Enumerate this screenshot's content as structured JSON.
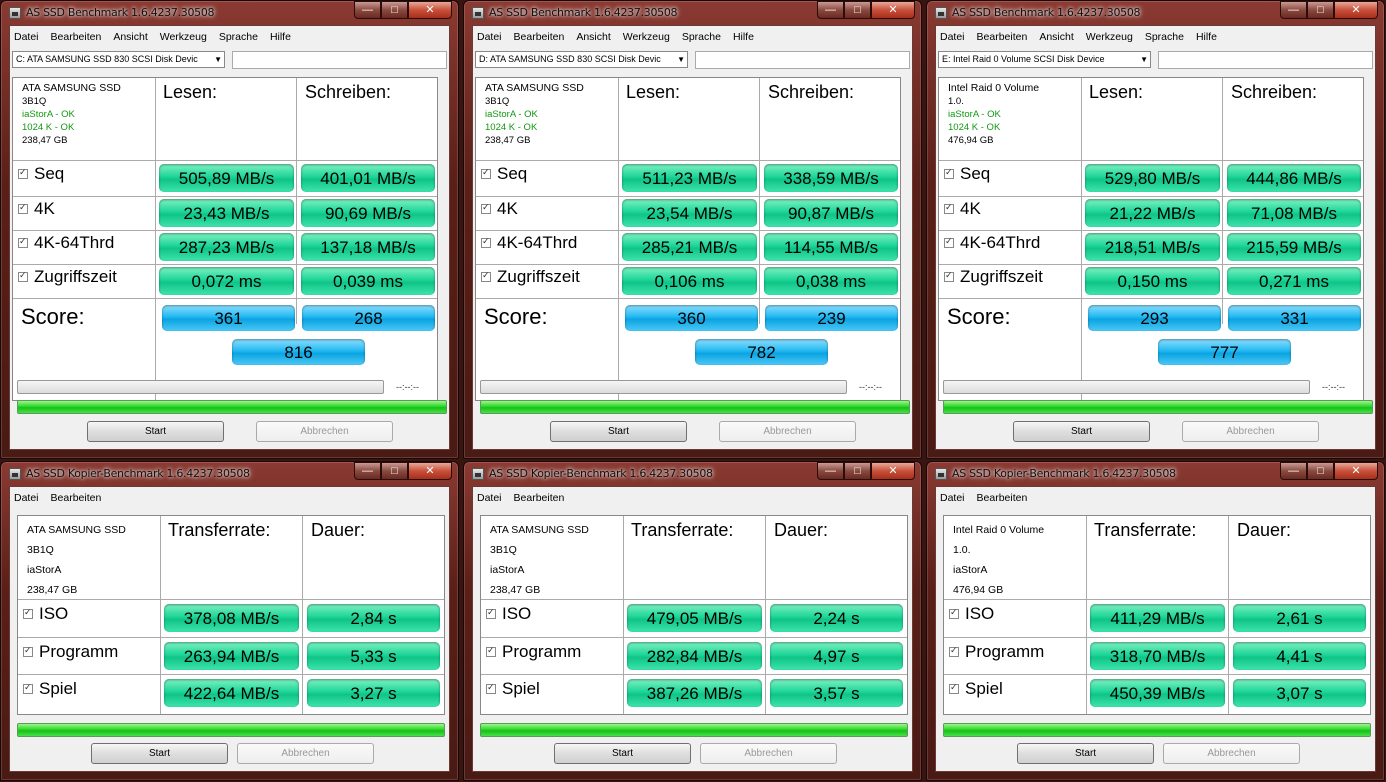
{
  "bench": {
    "title": "AS SSD Benchmark 1.6.4237.30508",
    "menu": [
      "Datei",
      "Bearbeiten",
      "Ansicht",
      "Werkzeug",
      "Sprache",
      "Hilfe"
    ],
    "col_read": "Lesen:",
    "col_write": "Schreiben:",
    "row_labels": [
      "Seq",
      "4K",
      "4K-64Thrd",
      "Zugriffszeit"
    ],
    "score_label": "Score:",
    "elapsed": "--:--:--",
    "start": "Start",
    "cancel": "Abbrechen",
    "windows": [
      {
        "drive": "C: ATA SAMSUNG SSD 830 SCSI Disk Devic",
        "info": [
          "ATA SAMSUNG SSD",
          "3B1Q",
          "iaStorA - OK",
          "1024 K - OK",
          "238,47 GB"
        ],
        "rows": [
          [
            "505,89 MB/s",
            "401,01 MB/s"
          ],
          [
            "23,43 MB/s",
            "90,69 MB/s"
          ],
          [
            "287,23 MB/s",
            "137,18 MB/s"
          ],
          [
            "0,072 ms",
            "0,039 ms"
          ]
        ],
        "score": [
          "361",
          "268",
          "816"
        ]
      },
      {
        "drive": "D: ATA SAMSUNG SSD 830 SCSI Disk Devic",
        "info": [
          "ATA SAMSUNG SSD",
          "3B1Q",
          "iaStorA - OK",
          "1024 K - OK",
          "238,47 GB"
        ],
        "rows": [
          [
            "511,23 MB/s",
            "338,59 MB/s"
          ],
          [
            "23,54 MB/s",
            "90,87 MB/s"
          ],
          [
            "285,21 MB/s",
            "114,55 MB/s"
          ],
          [
            "0,106 ms",
            "0,038 ms"
          ]
        ],
        "score": [
          "360",
          "239",
          "782"
        ]
      },
      {
        "drive": "E: Intel Raid 0 Volume SCSI Disk Device",
        "info": [
          "Intel Raid 0 Volume",
          "1.0.",
          "iaStorA - OK",
          "1024 K - OK",
          "476,94 GB"
        ],
        "rows": [
          [
            "529,80 MB/s",
            "444,86 MB/s"
          ],
          [
            "21,22 MB/s",
            "71,08 MB/s"
          ],
          [
            "218,51 MB/s",
            "215,59 MB/s"
          ],
          [
            "0,150 ms",
            "0,271 ms"
          ]
        ],
        "score": [
          "293",
          "331",
          "777"
        ]
      }
    ]
  },
  "copy": {
    "title": "AS SSD Kopier-Benchmark 1.6.4237.30508",
    "menu": [
      "Datei",
      "Bearbeiten"
    ],
    "col_rate": "Transferrate:",
    "col_time": "Dauer:",
    "row_labels": [
      "ISO",
      "Programm",
      "Spiel"
    ],
    "start": "Start",
    "cancel": "Abbrechen",
    "windows": [
      {
        "info": [
          "ATA SAMSUNG SSD",
          "3B1Q",
          "iaStorA",
          "238,47 GB"
        ],
        "rows": [
          [
            "378,08 MB/s",
            "2,84 s"
          ],
          [
            "263,94 MB/s",
            "5,33 s"
          ],
          [
            "422,64 MB/s",
            "3,27 s"
          ]
        ]
      },
      {
        "info": [
          "ATA SAMSUNG SSD",
          "3B1Q",
          "iaStorA",
          "238,47 GB"
        ],
        "rows": [
          [
            "479,05 MB/s",
            "2,24 s"
          ],
          [
            "282,84 MB/s",
            "4,97 s"
          ],
          [
            "387,26 MB/s",
            "3,57 s"
          ]
        ]
      },
      {
        "info": [
          "Intel Raid 0 Volume",
          "1.0.",
          "iaStorA",
          "476,94 GB"
        ],
        "rows": [
          [
            "411,29 MB/s",
            "2,61 s"
          ],
          [
            "318,70 MB/s",
            "4,41 s"
          ],
          [
            "450,39 MB/s",
            "3,07 s"
          ]
        ]
      }
    ]
  },
  "window_controls": {
    "minimize": "—",
    "maximize": "□",
    "close": "✕"
  }
}
